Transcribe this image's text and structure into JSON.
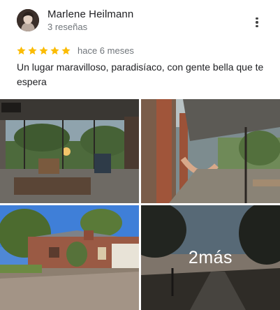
{
  "review": {
    "author": "Marlene Heilmann",
    "review_count": "3 reseñas",
    "rating": 5,
    "max_rating": 5,
    "time_ago": "hace 6 meses",
    "text": "Un lugar maravilloso, paradisíaco, con gente bella que te espera"
  },
  "icons": {
    "menu": "more-vert-icon",
    "star": "star-icon"
  },
  "colors": {
    "star": "#fbbc04",
    "secondary_text": "#70757a",
    "primary_text": "#202124"
  },
  "photos": {
    "more_label": "2más"
  }
}
